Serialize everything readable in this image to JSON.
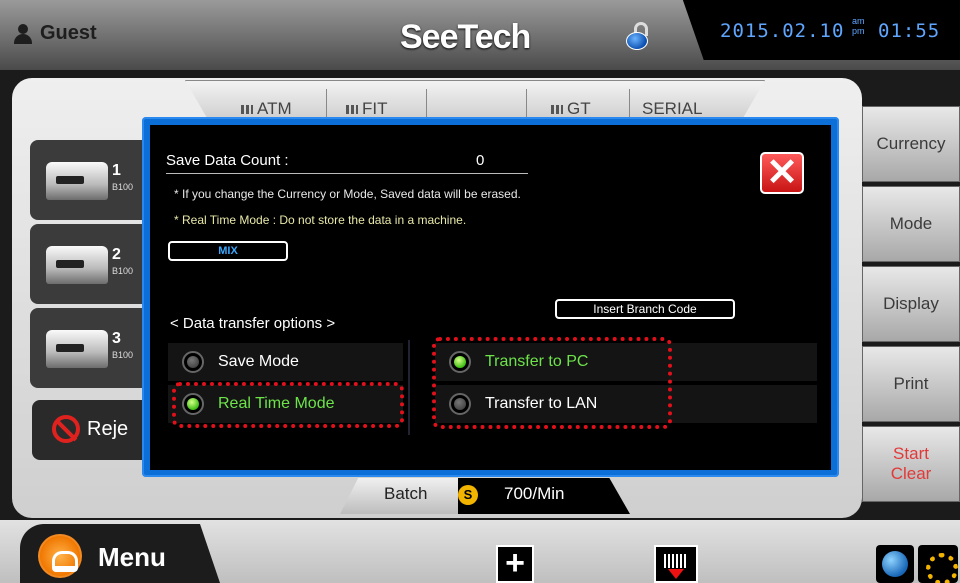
{
  "header": {
    "user": "Guest",
    "logo": "SeeTech",
    "date": "2015.02.10",
    "am": "am",
    "pm": "pm",
    "time": "01:55"
  },
  "tabs": [
    "ATM",
    "FIT",
    "",
    "GT",
    "SERIAL"
  ],
  "machines": [
    {
      "num": "1",
      "model": "B100"
    },
    {
      "num": "2",
      "model": "B100"
    },
    {
      "num": "3",
      "model": "B100"
    }
  ],
  "reject_label": "Reje",
  "side_buttons": {
    "currency": "Currency",
    "mode": "Mode",
    "display": "Display",
    "print": "Print",
    "start": "Start",
    "clear": "Clear"
  },
  "speed": {
    "batch": "Batch",
    "badge": "S",
    "value": "700/Min"
  },
  "menu_label": "Menu",
  "plus_label": "+",
  "modal": {
    "title": "Save Data Count :",
    "count": "0",
    "note1": "* If you change the Currency or Mode, Saved data will be erased.",
    "note2": "* Real Time Mode : Do not store the data in a machine.",
    "mix": "MIX",
    "close": "✕",
    "branch": "Insert Branch Code",
    "options_title": "< Data transfer options >",
    "save_mode": "Save Mode",
    "real_time_mode": "Real Time Mode",
    "transfer_pc": "Transfer to PC",
    "transfer_lan": "Transfer to LAN"
  },
  "state": {
    "save_mode_selected": false,
    "real_time_mode_selected": true,
    "transfer_pc_selected": true,
    "transfer_lan_selected": false
  },
  "colors": {
    "modal_border": "#0c6fd8",
    "accent_blue": "#5fa6ff",
    "selected_green": "#3fbf14",
    "highlight_red": "#e2101a"
  }
}
